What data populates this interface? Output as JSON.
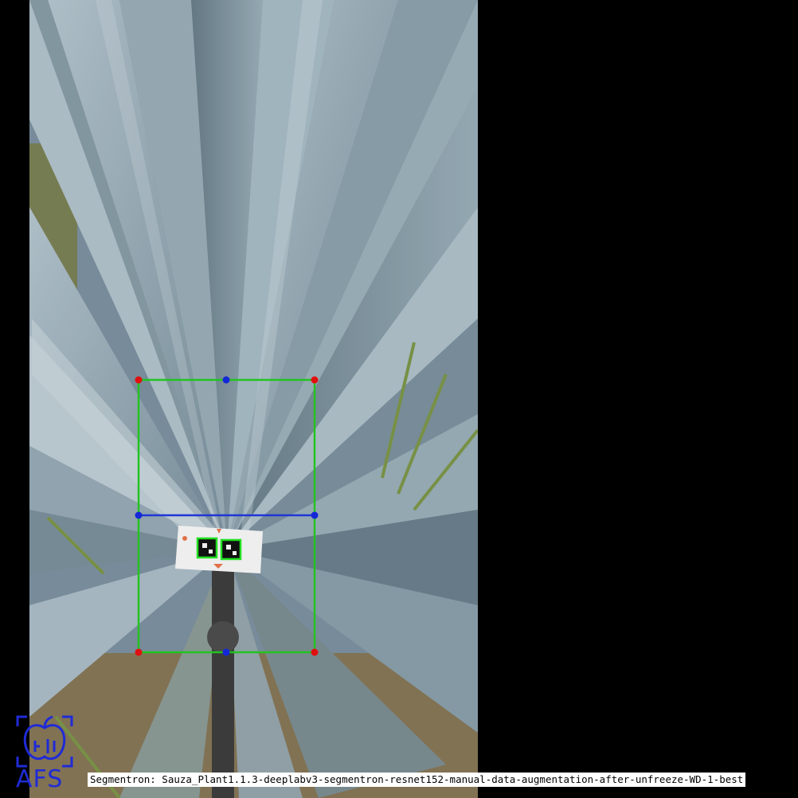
{
  "caption": "Segmentron: Sauza_Plant1.1.3-deeplabv3-segmentron-resnet152-manual-data-augmentation-after-unfreeze-WD-1-best",
  "logo": {
    "icon": "apple-scan-logo-icon",
    "text": "AFS",
    "color": "#1f2bd6"
  },
  "overlay": {
    "box_color": "#22c322",
    "corner_color": "#e01010",
    "midpoint_color": "#1428d8",
    "measure_line_color": "#1f36d6",
    "tag_outline_color": "#22e022"
  },
  "scene_colors": {
    "background": "#000000",
    "leaf_light": "#9fb2bd",
    "leaf_mid": "#7a909c",
    "leaf_dark": "#4f6470",
    "ground": "#7a6a4a",
    "grass": "#6f8a3a"
  }
}
